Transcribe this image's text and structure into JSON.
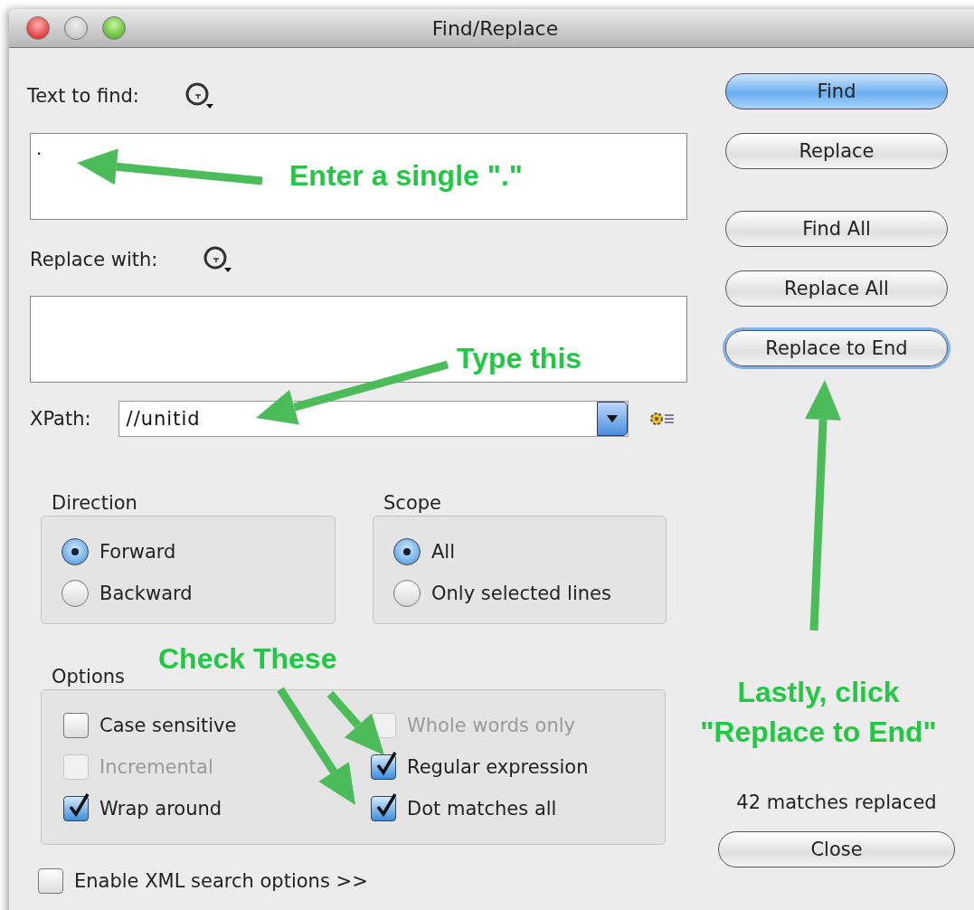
{
  "window": {
    "title": "Find/Replace",
    "controls": [
      {
        "kind": "close",
        "disabled": false
      },
      {
        "kind": "minimize",
        "disabled": true
      },
      {
        "kind": "zoom",
        "disabled": false
      }
    ]
  },
  "find": {
    "label": "Text to find:",
    "value": "."
  },
  "replace": {
    "label": "Replace with:"
  },
  "xpath": {
    "label": "XPath:",
    "value": "//unitid"
  },
  "direction": {
    "title": "Direction",
    "options": [
      {
        "label": "Forward",
        "selected": true
      },
      {
        "label": "Backward",
        "selected": false
      }
    ]
  },
  "scope": {
    "title": "Scope",
    "options": [
      {
        "label": "All",
        "selected": true
      },
      {
        "label": "Only selected lines",
        "selected": false
      }
    ]
  },
  "options": {
    "title": "Options",
    "checkboxes": [
      {
        "label": "Case sensitive",
        "checked": false,
        "disabled": false
      },
      {
        "label": "Incremental",
        "checked": false,
        "disabled": true
      },
      {
        "label": "Wrap around",
        "checked": true,
        "disabled": false
      },
      {
        "label": "Whole words only",
        "checked": false,
        "disabled": true
      },
      {
        "label": "Regular expression",
        "checked": true,
        "disabled": false
      },
      {
        "label": "Dot matches all",
        "checked": true,
        "disabled": false
      }
    ]
  },
  "xml_options": {
    "label": "Enable XML search options >>",
    "checked": false,
    "disabled": false
  },
  "buttons": [
    {
      "label": "Find",
      "kind": "default",
      "focused": false
    },
    {
      "label": "Replace",
      "kind": "normal",
      "focused": false
    },
    {
      "label": "Find All",
      "kind": "normal",
      "focused": false
    },
    {
      "label": "Replace All",
      "kind": "normal",
      "focused": false
    },
    {
      "label": "Replace to End",
      "kind": "normal",
      "focused": true
    }
  ],
  "status": "42 matches replaced",
  "close_button": {
    "label": "Close"
  },
  "annotations": [
    {
      "text": "Enter a single \".\""
    },
    {
      "text": "Type this"
    },
    {
      "text": "Check These"
    },
    {
      "text": "Lastly, click"
    },
    {
      "text": "\"Replace to End\""
    }
  ]
}
